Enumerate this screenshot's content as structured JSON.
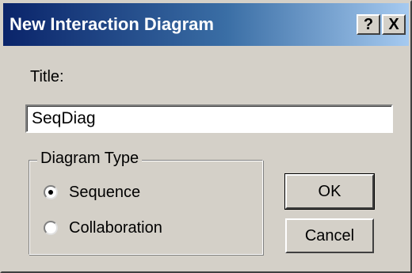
{
  "window": {
    "title": "New Interaction Diagram",
    "help_label": "?",
    "close_label": "X"
  },
  "form": {
    "title_label": "Title:",
    "title_value": "SeqDiag"
  },
  "diagram_type": {
    "legend": "Diagram Type",
    "options": [
      {
        "label": "Sequence",
        "selected": true
      },
      {
        "label": "Collaboration",
        "selected": false
      }
    ]
  },
  "buttons": {
    "ok_label": "OK",
    "cancel_label": "Cancel"
  },
  "colors": {
    "dialog_face": "#d4d0c8",
    "titlebar_start": "#0a246a",
    "titlebar_end": "#a6caf0"
  }
}
